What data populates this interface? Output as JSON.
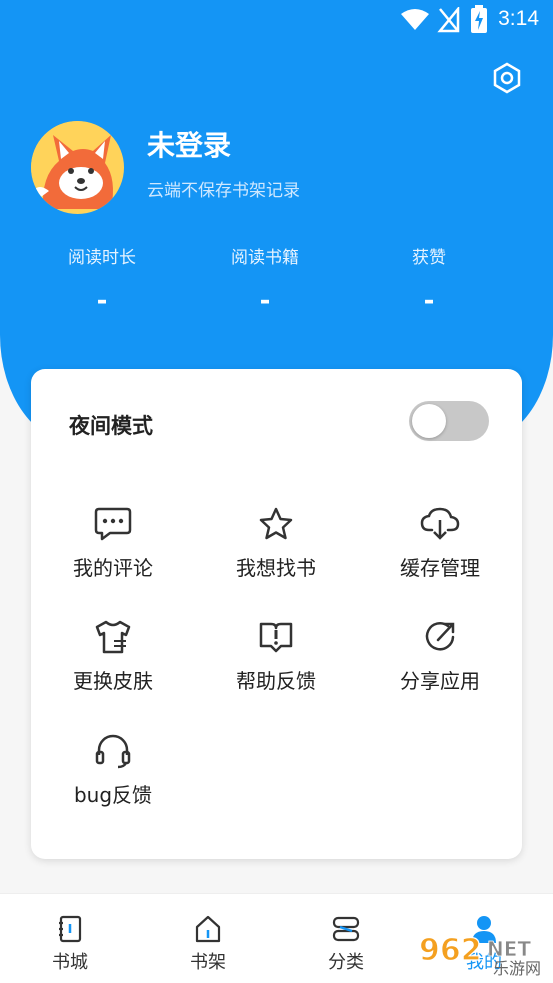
{
  "status_bar": {
    "time": "3:14"
  },
  "profile": {
    "username": "未登录",
    "subtitle": "云端不保存书架记录"
  },
  "stats": [
    {
      "label": "阅读时长",
      "value": "-"
    },
    {
      "label": "阅读书籍",
      "value": "-"
    },
    {
      "label": "获赞",
      "value": "-"
    }
  ],
  "night_mode": {
    "label": "夜间模式",
    "enabled": false
  },
  "menu": [
    {
      "label": "我的评论",
      "icon": "comment-icon"
    },
    {
      "label": "我想找书",
      "icon": "star-icon"
    },
    {
      "label": "缓存管理",
      "icon": "cloud-download-icon"
    },
    {
      "label": "更换皮肤",
      "icon": "tshirt-icon"
    },
    {
      "label": "帮助反馈",
      "icon": "help-icon"
    },
    {
      "label": "分享应用",
      "icon": "share-icon"
    },
    {
      "label": "bug反馈",
      "icon": "headset-icon"
    }
  ],
  "bottom_nav": [
    {
      "label": "书城",
      "icon": "book-icon"
    },
    {
      "label": "书架",
      "icon": "home-icon"
    },
    {
      "label": "分类",
      "icon": "category-icon"
    },
    {
      "label": "我的",
      "icon": "user-icon",
      "active": true
    }
  ],
  "watermark": {
    "text1": "962",
    "text2": "NET",
    "text3": "乐游网"
  },
  "colors": {
    "primary": "#1495f5",
    "toggle_off": "#c8c8c8"
  }
}
